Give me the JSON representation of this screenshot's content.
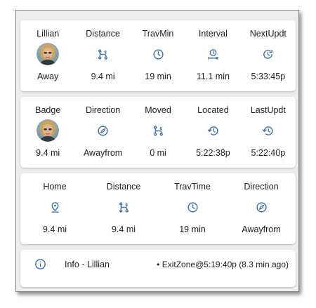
{
  "card1": {
    "headers": [
      "Lillian",
      "Distance",
      "TravMin",
      "Interval",
      "NextUpdt"
    ],
    "values": [
      "Away",
      "9.4 mi",
      "19 min",
      "11.1 min",
      "5:33:45p"
    ]
  },
  "card2": {
    "headers": [
      "Badge",
      "Direction",
      "Moved",
      "Located",
      "LastUpdt"
    ],
    "values": [
      "9.4 mi",
      "Awayfrom",
      "0 mi",
      "5:22:38p",
      "5:22:40p"
    ]
  },
  "card3": {
    "headers": [
      "Home",
      "Distance",
      "TravTime",
      "Direction"
    ],
    "values": [
      "9.4 mi",
      "9.4 mi",
      "19 min",
      "Awayfrom"
    ]
  },
  "info": {
    "label": "Info - Lillian",
    "status": "• ExitZone@5:19:40p (8.3 min ago)"
  },
  "colors": {
    "icon": "#44739e",
    "card": "#ffffff",
    "background": "#ededed"
  },
  "icons": {
    "card1": [
      "avatar",
      "source-branch-icon",
      "clock-icon",
      "timer-interval-icon",
      "clock-refresh-icon"
    ],
    "card2": [
      "avatar",
      "compass-icon",
      "source-branch-icon",
      "history-icon",
      "history-icon"
    ],
    "card3": [
      "map-marker-icon",
      "source-branch-icon",
      "clock-icon",
      "compass-icon"
    ],
    "info": "information-icon"
  }
}
